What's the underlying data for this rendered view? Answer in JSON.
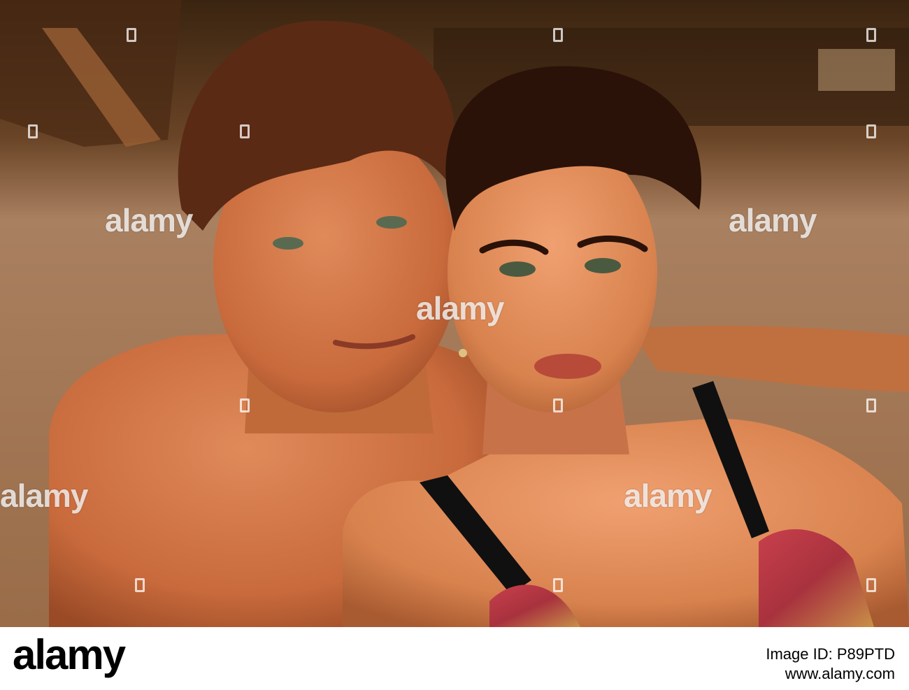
{
  "watermark": {
    "text": "alamy",
    "color": "#ffffff"
  },
  "footer": {
    "logo": "alamy",
    "image_id": "Image ID: P89PTD",
    "url": "www.alamy.com"
  },
  "colors": {
    "background_sand": "#a07248",
    "skin_warm": "#d87a4e",
    "hair_dark": "#2a1208",
    "hair_brown": "#5a2a14",
    "top_red": "#b83a44",
    "strap": "#101010"
  }
}
